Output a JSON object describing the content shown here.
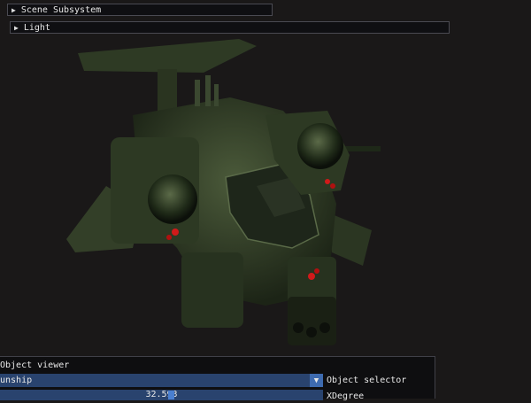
{
  "panels": {
    "scene_subsystem": {
      "label": "Scene Subsystem",
      "arrow": "▶"
    },
    "light": {
      "label": "Light",
      "arrow": "▶"
    }
  },
  "object_viewer": {
    "title": "Object viewer",
    "selector_value": "unship",
    "selector_arrow": "▼",
    "selector_label": "Object selector",
    "xdegree_value": "32.593",
    "xdegree_label": "XDegree"
  },
  "colors": {
    "accent": "#3e6bb0",
    "frame_bg": "#29436e",
    "background": "#1a1818"
  }
}
